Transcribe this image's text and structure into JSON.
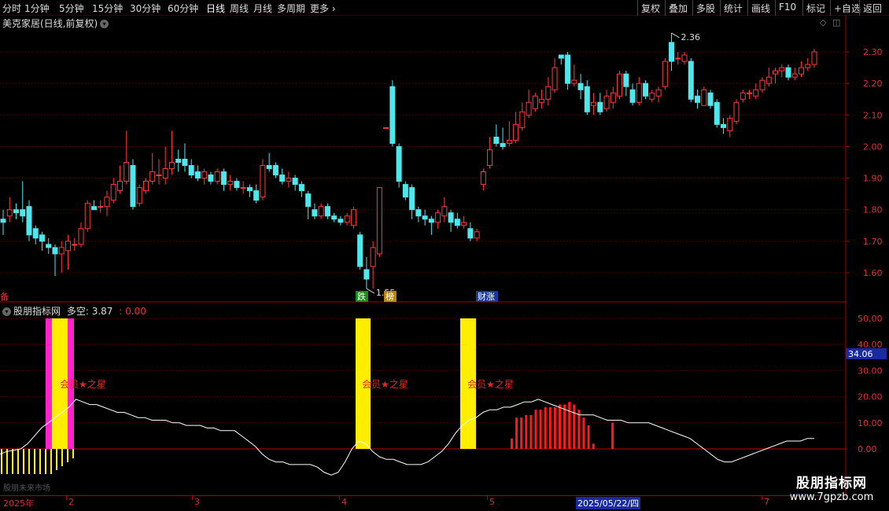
{
  "toolbar": {
    "periods": [
      "分时",
      "1分钟",
      "5分钟",
      "15分钟",
      "30分钟",
      "60分钟",
      "日线",
      "周线",
      "月线",
      "多周期",
      "更多"
    ],
    "active_period": "日线",
    "more_chevron": "›",
    "right_buttons": [
      "复权",
      "叠加",
      "多股",
      "统计",
      "画线",
      "F10",
      "标记",
      "+自选",
      "返回"
    ]
  },
  "stock": {
    "title": "美克家居(日线,前复权)",
    "high_label": "2.36",
    "low_label": "1.55",
    "markers": [
      {
        "text": "跌",
        "color": "#1e8a1e"
      },
      {
        "text": "榜",
        "color": "#b8860b"
      },
      {
        "text": "财涨",
        "color": "#1a3a9a"
      }
    ],
    "left_marker": "备"
  },
  "indicator": {
    "name": "股朋指标网",
    "label": "多空:",
    "value": "3.87",
    "value2": ": 0.00",
    "member_text": "会员★之星",
    "current_value": "34.06",
    "bottom_left_text": "股朋未来市场"
  },
  "axes": {
    "price_ticks": [
      "2.30",
      "2.20",
      "2.10",
      "2.00",
      "1.90",
      "1.80",
      "1.70",
      "1.60"
    ],
    "ind_ticks": [
      "50.00",
      "40.00",
      "30.00",
      "20.00",
      "10.00",
      "0.00"
    ]
  },
  "dates": {
    "labels": [
      "2025年",
      "2",
      "3",
      "4",
      "5",
      "7"
    ],
    "highlight": "2025/05/22/四"
  },
  "watermark": {
    "title": "股朋指标网",
    "url": "www.7gpzb.com"
  },
  "colors": {
    "up": "#ff3b3b",
    "down": "#4ee8ec",
    "grid": "#5a0000",
    "yellow": "#ffee00",
    "magenta": "#ff22cc"
  },
  "chart_data": {
    "type": "candlestick",
    "price_axis": [
      1.6,
      2.3
    ],
    "last_close": 2.3,
    "candles": [
      {
        "o": 1.77,
        "c": 1.76,
        "h": 1.8,
        "l": 1.72
      },
      {
        "o": 1.78,
        "c": 1.8,
        "h": 1.84,
        "l": 1.76
      },
      {
        "o": 1.8,
        "c": 1.79,
        "h": 1.82,
        "l": 1.77
      },
      {
        "o": 1.8,
        "c": 1.78,
        "h": 1.89,
        "l": 1.76
      },
      {
        "o": 1.81,
        "c": 1.72,
        "h": 1.83,
        "l": 1.7
      },
      {
        "o": 1.74,
        "c": 1.71,
        "h": 1.75,
        "l": 1.69
      },
      {
        "o": 1.72,
        "c": 1.7,
        "h": 1.73,
        "l": 1.67
      },
      {
        "o": 1.69,
        "c": 1.68,
        "h": 1.71,
        "l": 1.66
      },
      {
        "o": 1.68,
        "c": 1.66,
        "h": 1.69,
        "l": 1.59
      },
      {
        "o": 1.66,
        "c": 1.68,
        "h": 1.7,
        "l": 1.6
      },
      {
        "o": 1.67,
        "c": 1.7,
        "h": 1.72,
        "l": 1.61
      },
      {
        "o": 1.69,
        "c": 1.69,
        "h": 1.71,
        "l": 1.67
      },
      {
        "o": 1.69,
        "c": 1.74,
        "h": 1.76,
        "l": 1.68
      },
      {
        "o": 1.74,
        "c": 1.82,
        "h": 1.83,
        "l": 1.73
      },
      {
        "o": 1.81,
        "c": 1.8,
        "h": 1.83,
        "l": 1.8
      },
      {
        "o": 1.81,
        "c": 1.81,
        "h": 1.83,
        "l": 1.79
      },
      {
        "o": 1.81,
        "c": 1.84,
        "h": 1.86,
        "l": 1.78
      },
      {
        "o": 1.83,
        "c": 1.88,
        "h": 1.9,
        "l": 1.82
      },
      {
        "o": 1.86,
        "c": 1.89,
        "h": 1.94,
        "l": 1.85
      },
      {
        "o": 1.89,
        "c": 1.95,
        "h": 2.05,
        "l": 1.88
      },
      {
        "o": 1.94,
        "c": 1.81,
        "h": 1.96,
        "l": 1.8
      },
      {
        "o": 1.82,
        "c": 1.87,
        "h": 1.88,
        "l": 1.81
      },
      {
        "o": 1.86,
        "c": 1.89,
        "h": 1.9,
        "l": 1.85
      },
      {
        "o": 1.89,
        "c": 1.92,
        "h": 1.98,
        "l": 1.88
      },
      {
        "o": 1.91,
        "c": 1.91,
        "h": 1.96,
        "l": 1.88
      },
      {
        "o": 1.9,
        "c": 1.93,
        "h": 2.0,
        "l": 1.88
      },
      {
        "o": 1.93,
        "c": 1.95,
        "h": 2.05,
        "l": 1.91
      },
      {
        "o": 1.96,
        "c": 1.95,
        "h": 1.99,
        "l": 1.92
      },
      {
        "o": 1.96,
        "c": 1.94,
        "h": 2.01,
        "l": 1.92
      },
      {
        "o": 1.94,
        "c": 1.91,
        "h": 1.96,
        "l": 1.9
      },
      {
        "o": 1.92,
        "c": 1.9,
        "h": 1.94,
        "l": 1.89
      },
      {
        "o": 1.9,
        "c": 1.92,
        "h": 1.93,
        "l": 1.88
      },
      {
        "o": 1.91,
        "c": 1.89,
        "h": 1.92,
        "l": 1.88
      },
      {
        "o": 1.89,
        "c": 1.92,
        "h": 1.93,
        "l": 1.88
      },
      {
        "o": 1.92,
        "c": 1.88,
        "h": 1.93,
        "l": 1.86
      },
      {
        "o": 1.88,
        "c": 1.89,
        "h": 1.91,
        "l": 1.86
      },
      {
        "o": 1.89,
        "c": 1.87,
        "h": 1.9,
        "l": 1.86
      },
      {
        "o": 1.87,
        "c": 1.87,
        "h": 1.89,
        "l": 1.85
      },
      {
        "o": 1.87,
        "c": 1.86,
        "h": 1.88,
        "l": 1.84
      },
      {
        "o": 1.86,
        "c": 1.83,
        "h": 1.88,
        "l": 1.82
      },
      {
        "o": 1.84,
        "c": 1.94,
        "h": 1.96,
        "l": 1.83
      },
      {
        "o": 1.94,
        "c": 1.93,
        "h": 1.98,
        "l": 1.92
      },
      {
        "o": 1.94,
        "c": 1.91,
        "h": 1.95,
        "l": 1.9
      },
      {
        "o": 1.91,
        "c": 1.89,
        "h": 1.93,
        "l": 1.88
      },
      {
        "o": 1.89,
        "c": 1.9,
        "h": 1.92,
        "l": 1.87
      },
      {
        "o": 1.9,
        "c": 1.88,
        "h": 1.91,
        "l": 1.86
      },
      {
        "o": 1.88,
        "c": 1.86,
        "h": 1.89,
        "l": 1.84
      },
      {
        "o": 1.85,
        "c": 1.81,
        "h": 1.86,
        "l": 1.77
      },
      {
        "o": 1.8,
        "c": 1.78,
        "h": 1.82,
        "l": 1.77
      },
      {
        "o": 1.78,
        "c": 1.81,
        "h": 1.82,
        "l": 1.77
      },
      {
        "o": 1.81,
        "c": 1.78,
        "h": 1.82,
        "l": 1.77
      },
      {
        "o": 1.78,
        "c": 1.77,
        "h": 1.79,
        "l": 1.76
      },
      {
        "o": 1.77,
        "c": 1.76,
        "h": 1.78,
        "l": 1.75
      },
      {
        "o": 1.76,
        "c": 1.78,
        "h": 1.79,
        "l": 1.75
      },
      {
        "o": 1.75,
        "c": 1.8,
        "h": 1.81,
        "l": 1.74
      },
      {
        "o": 1.72,
        "c": 1.62,
        "h": 1.73,
        "l": 1.61
      },
      {
        "o": 1.61,
        "c": 1.58,
        "h": 1.65,
        "l": 1.55
      },
      {
        "o": 1.62,
        "c": 1.68,
        "h": 1.7,
        "l": 1.55
      },
      {
        "o": 1.66,
        "c": 1.87,
        "h": 1.87,
        "l": 1.65
      },
      {
        "o": 2.06,
        "c": 2.06,
        "h": 2.06,
        "l": 2.06
      },
      {
        "o": 2.19,
        "c": 2.01,
        "h": 2.21,
        "l": 2.0
      },
      {
        "o": 2.0,
        "c": 1.89,
        "h": 2.01,
        "l": 1.87
      },
      {
        "o": 1.88,
        "c": 1.84,
        "h": 1.89,
        "l": 1.83
      },
      {
        "o": 1.87,
        "c": 1.8,
        "h": 1.88,
        "l": 1.77
      },
      {
        "o": 1.8,
        "c": 1.78,
        "h": 1.81,
        "l": 1.76
      },
      {
        "o": 1.78,
        "c": 1.77,
        "h": 1.8,
        "l": 1.75
      },
      {
        "o": 1.77,
        "c": 1.76,
        "h": 1.78,
        "l": 1.72
      },
      {
        "o": 1.76,
        "c": 1.79,
        "h": 1.8,
        "l": 1.74
      },
      {
        "o": 1.78,
        "c": 1.81,
        "h": 1.84,
        "l": 1.76
      },
      {
        "o": 1.79,
        "c": 1.76,
        "h": 1.8,
        "l": 1.73
      },
      {
        "o": 1.77,
        "c": 1.75,
        "h": 1.79,
        "l": 1.74
      },
      {
        "o": 1.75,
        "c": 1.76,
        "h": 1.78,
        "l": 1.74
      },
      {
        "o": 1.74,
        "c": 1.71,
        "h": 1.76,
        "l": 1.7
      },
      {
        "o": 1.71,
        "c": 1.73,
        "h": 1.74,
        "l": 1.7
      },
      {
        "o": 1.88,
        "c": 1.92,
        "h": 1.93,
        "l": 1.86
      },
      {
        "o": 1.94,
        "c": 1.99,
        "h": 2.03,
        "l": 1.93
      },
      {
        "o": 2.03,
        "c": 2.01,
        "h": 2.07,
        "l": 2.0
      },
      {
        "o": 2.01,
        "c": 2.0,
        "h": 2.06,
        "l": 1.99
      },
      {
        "o": 2.01,
        "c": 2.02,
        "h": 2.08,
        "l": 2.0
      },
      {
        "o": 2.02,
        "c": 2.07,
        "h": 2.11,
        "l": 2.01
      },
      {
        "o": 2.06,
        "c": 2.11,
        "h": 2.14,
        "l": 2.05
      },
      {
        "o": 2.1,
        "c": 2.14,
        "h": 2.18,
        "l": 2.09
      },
      {
        "o": 2.12,
        "c": 2.16,
        "h": 2.17,
        "l": 2.11
      },
      {
        "o": 2.14,
        "c": 2.15,
        "h": 2.18,
        "l": 2.12
      },
      {
        "o": 2.15,
        "c": 2.19,
        "h": 2.22,
        "l": 2.13
      },
      {
        "o": 2.18,
        "c": 2.25,
        "h": 2.28,
        "l": 2.17
      },
      {
        "o": 2.29,
        "c": 2.28,
        "h": 2.29,
        "l": 2.26
      },
      {
        "o": 2.29,
        "c": 2.2,
        "h": 2.3,
        "l": 2.18
      },
      {
        "o": 2.2,
        "c": 2.21,
        "h": 2.26,
        "l": 2.19
      },
      {
        "o": 2.2,
        "c": 2.18,
        "h": 2.23,
        "l": 2.15
      },
      {
        "o": 2.19,
        "c": 2.11,
        "h": 2.21,
        "l": 2.1
      },
      {
        "o": 2.13,
        "c": 2.14,
        "h": 2.17,
        "l": 2.1
      },
      {
        "o": 2.14,
        "c": 2.11,
        "h": 2.17,
        "l": 2.1
      },
      {
        "o": 2.12,
        "c": 2.16,
        "h": 2.18,
        "l": 2.11
      },
      {
        "o": 2.14,
        "c": 2.17,
        "h": 2.19,
        "l": 2.12
      },
      {
        "o": 2.16,
        "c": 2.23,
        "h": 2.24,
        "l": 2.15
      },
      {
        "o": 2.23,
        "c": 2.19,
        "h": 2.24,
        "l": 2.16
      },
      {
        "o": 2.18,
        "c": 2.14,
        "h": 2.2,
        "l": 2.13
      },
      {
        "o": 2.14,
        "c": 2.2,
        "h": 2.22,
        "l": 2.13
      },
      {
        "o": 2.2,
        "c": 2.16,
        "h": 2.21,
        "l": 2.15
      },
      {
        "o": 2.15,
        "c": 2.17,
        "h": 2.18,
        "l": 2.14
      },
      {
        "o": 2.16,
        "c": 2.18,
        "h": 2.19,
        "l": 2.14
      },
      {
        "o": 2.19,
        "c": 2.27,
        "h": 2.28,
        "l": 2.18
      },
      {
        "o": 2.33,
        "c": 2.27,
        "h": 2.36,
        "l": 2.24
      },
      {
        "o": 2.28,
        "c": 2.28,
        "h": 2.3,
        "l": 2.26
      },
      {
        "o": 2.27,
        "c": 2.29,
        "h": 2.3,
        "l": 2.26
      },
      {
        "o": 2.27,
        "c": 2.15,
        "h": 2.28,
        "l": 2.14
      },
      {
        "o": 2.16,
        "c": 2.14,
        "h": 2.18,
        "l": 2.12
      },
      {
        "o": 2.13,
        "c": 2.18,
        "h": 2.19,
        "l": 2.13
      },
      {
        "o": 2.17,
        "c": 2.13,
        "h": 2.18,
        "l": 2.12
      },
      {
        "o": 2.14,
        "c": 2.07,
        "h": 2.15,
        "l": 2.06
      },
      {
        "o": 2.07,
        "c": 2.06,
        "h": 2.09,
        "l": 2.04
      },
      {
        "o": 2.05,
        "c": 2.09,
        "h": 2.1,
        "l": 2.03
      },
      {
        "o": 2.08,
        "c": 2.14,
        "h": 2.15,
        "l": 2.07
      },
      {
        "o": 2.15,
        "c": 2.17,
        "h": 2.18,
        "l": 2.14
      },
      {
        "o": 2.17,
        "c": 2.17,
        "h": 2.18,
        "l": 2.15
      },
      {
        "o": 2.16,
        "c": 2.18,
        "h": 2.2,
        "l": 2.15
      },
      {
        "o": 2.18,
        "c": 2.21,
        "h": 2.22,
        "l": 2.17
      },
      {
        "o": 2.2,
        "c": 2.22,
        "h": 2.25,
        "l": 2.19
      },
      {
        "o": 2.23,
        "c": 2.24,
        "h": 2.25,
        "l": 2.2
      },
      {
        "o": 2.24,
        "c": 2.25,
        "h": 2.26,
        "l": 2.22
      },
      {
        "o": 2.25,
        "c": 2.22,
        "h": 2.26,
        "l": 2.21
      },
      {
        "o": 2.22,
        "c": 2.23,
        "h": 2.25,
        "l": 2.21
      },
      {
        "o": 2.23,
        "c": 2.25,
        "h": 2.27,
        "l": 2.22
      },
      {
        "o": 2.25,
        "c": 2.26,
        "h": 2.28,
        "l": 2.24
      },
      {
        "o": 2.26,
        "c": 2.3,
        "h": 2.31,
        "l": 2.25
      }
    ],
    "indicator_axis": [
      -10,
      55
    ],
    "indicator_line": [
      -2,
      -1,
      -0.5,
      0,
      2,
      5,
      8,
      10,
      12,
      14,
      16,
      19,
      18,
      17,
      17,
      16,
      15,
      14,
      14,
      13,
      12,
      12,
      11,
      11,
      11,
      10,
      10,
      9,
      9,
      9,
      8,
      8,
      7,
      7,
      7,
      5,
      3,
      1,
      -2,
      -4,
      -5,
      -5,
      -6,
      -6,
      -6,
      -6,
      -7,
      -9,
      -10,
      -9,
      -5,
      0,
      3,
      2,
      -1,
      -3,
      -4,
      -4,
      -5,
      -6,
      -6,
      -6,
      -5,
      -3,
      -1,
      2,
      6,
      9,
      11,
      12,
      14,
      15,
      15,
      16,
      16,
      17,
      18,
      18,
      19,
      18,
      17,
      16,
      15,
      14,
      13,
      13,
      13,
      12,
      11,
      11,
      11,
      10,
      10,
      10,
      10,
      9,
      8,
      7,
      6,
      5,
      4,
      2,
      0,
      -2,
      -4,
      -5,
      -5,
      -4,
      -3,
      -2,
      -1,
      0,
      1,
      2,
      3,
      3,
      3,
      4,
      4
    ],
    "red_bars": [
      4,
      12,
      12,
      13,
      13,
      15,
      15,
      16,
      16,
      16,
      17,
      17,
      18,
      17,
      15,
      12,
      9,
      2,
      0,
      0,
      0,
      10
    ],
    "member_label_positions": [
      "first",
      "second",
      "third"
    ]
  }
}
